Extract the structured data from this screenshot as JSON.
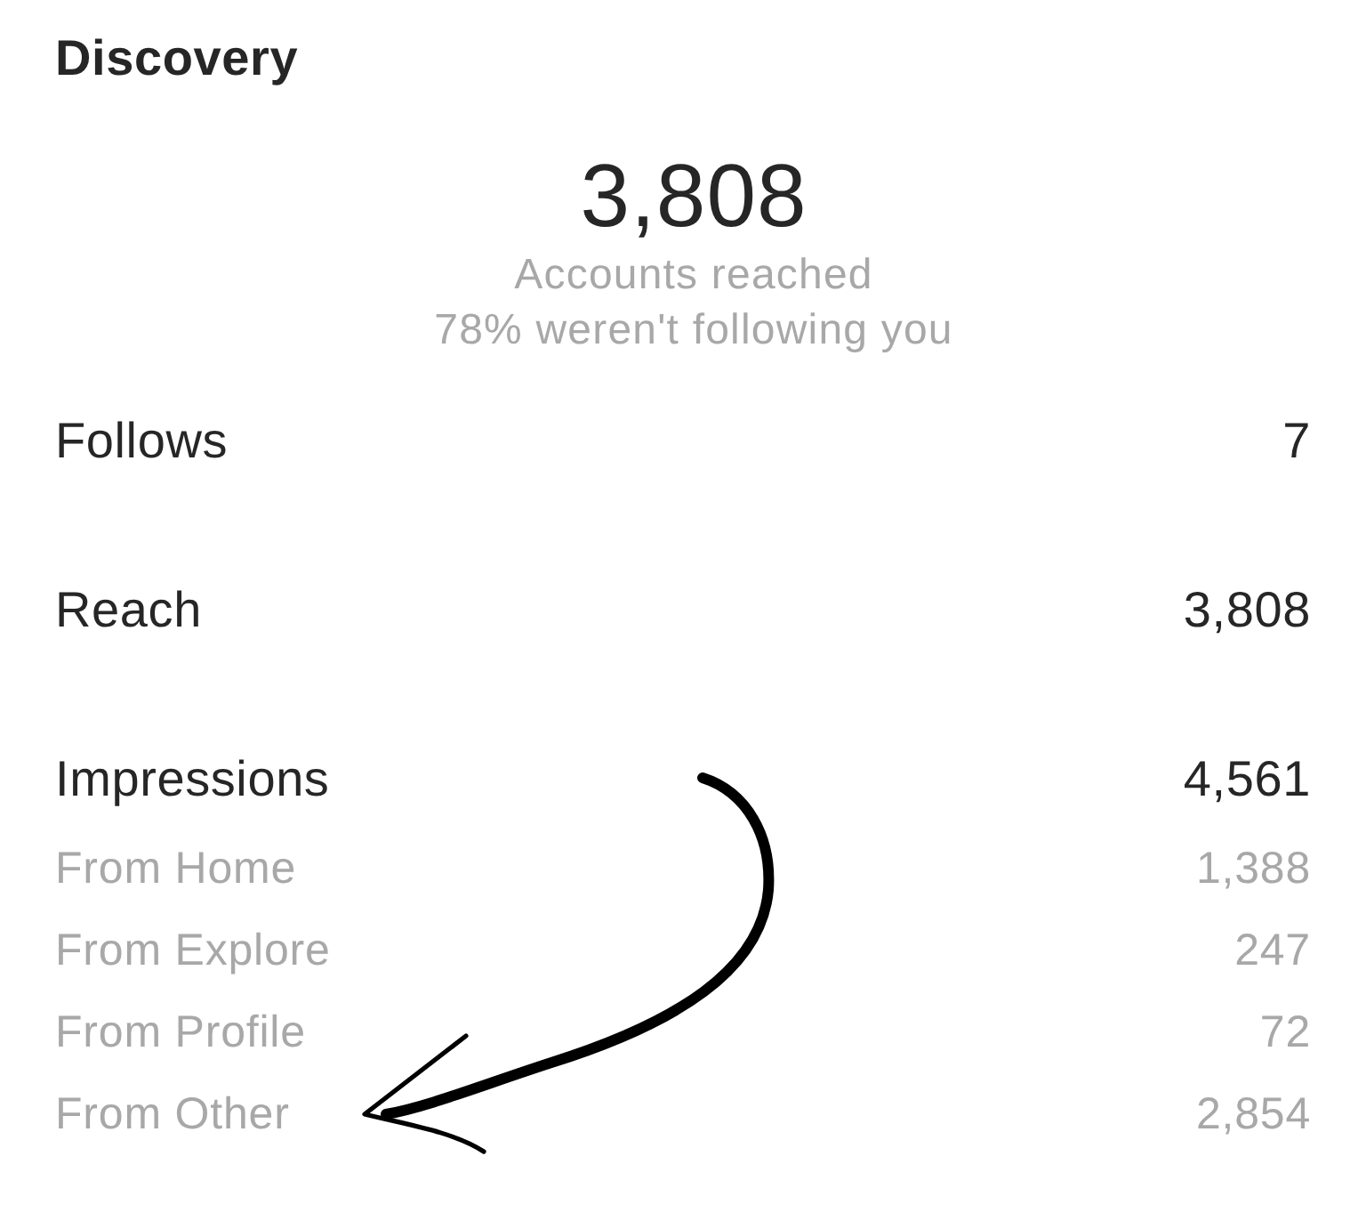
{
  "section": {
    "title": "Discovery"
  },
  "summary": {
    "value": "3,808",
    "label": "Accounts reached",
    "note": "78% weren't following you"
  },
  "metrics": [
    {
      "label": "Follows",
      "value": "7"
    },
    {
      "label": "Reach",
      "value": "3,808"
    },
    {
      "label": "Impressions",
      "value": "4,561",
      "breakdown": [
        {
          "label": "From Home",
          "value": "1,388"
        },
        {
          "label": "From Explore",
          "value": "247"
        },
        {
          "label": "From Profile",
          "value": "72"
        },
        {
          "label": "From Other",
          "value": "2,854"
        }
      ]
    }
  ]
}
